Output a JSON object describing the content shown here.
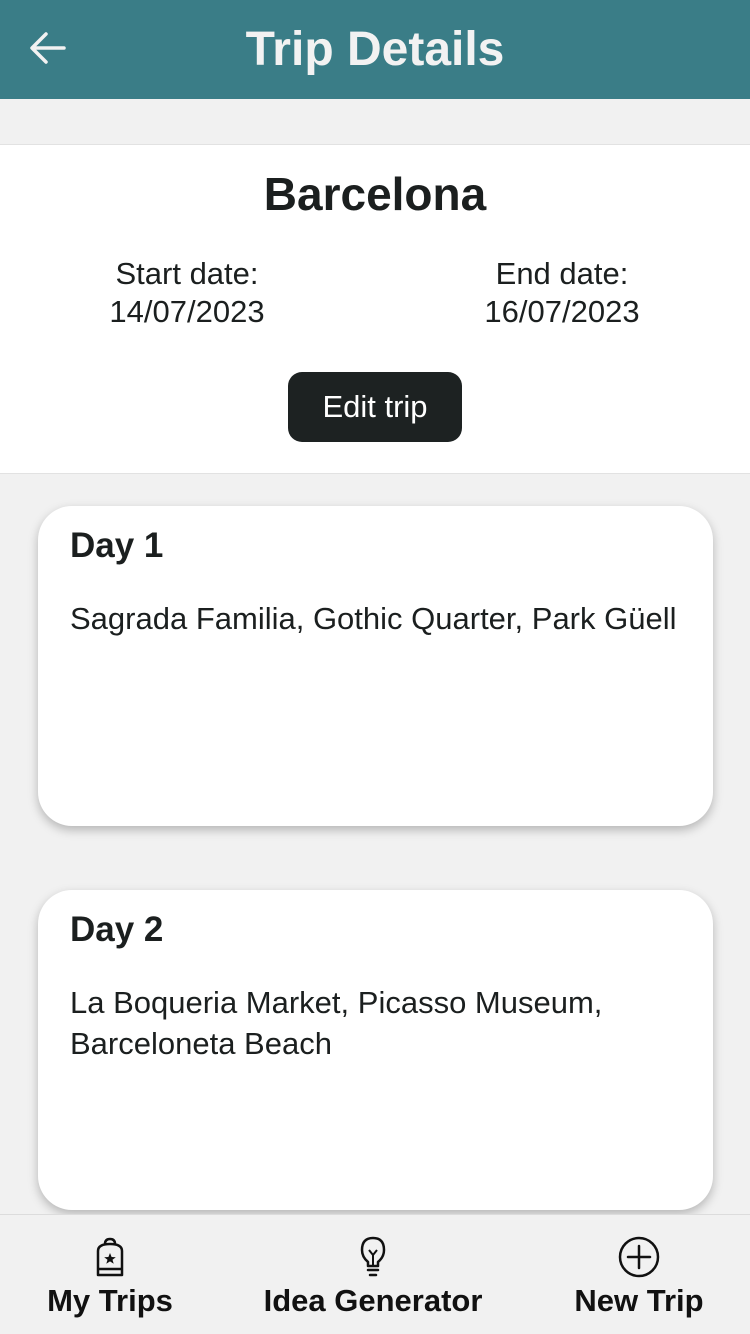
{
  "header": {
    "title": "Trip Details",
    "back_icon": "arrow-left-icon"
  },
  "trip": {
    "name": "Barcelona",
    "start_label": "Start date:",
    "start_date": "14/07/2023",
    "end_label": "End date:",
    "end_date": "16/07/2023",
    "edit_label": "Edit trip"
  },
  "days": [
    {
      "title": "Day 1",
      "activities": "Sagrada Familia, Gothic Quarter, Park Güell"
    },
    {
      "title": "Day 2",
      "activities": "La Boqueria Market, Picasso Museum, Barceloneta Beach"
    }
  ],
  "nav": {
    "items": [
      {
        "label": "My Trips",
        "icon": "backpack-icon"
      },
      {
        "label": "Idea Generator",
        "icon": "lightbulb-icon"
      },
      {
        "label": "New Trip",
        "icon": "plus-circle-icon"
      }
    ]
  },
  "colors": {
    "header_bg": "#3a7d87",
    "button_bg": "#1d2222",
    "page_bg": "#f1f1f1"
  }
}
